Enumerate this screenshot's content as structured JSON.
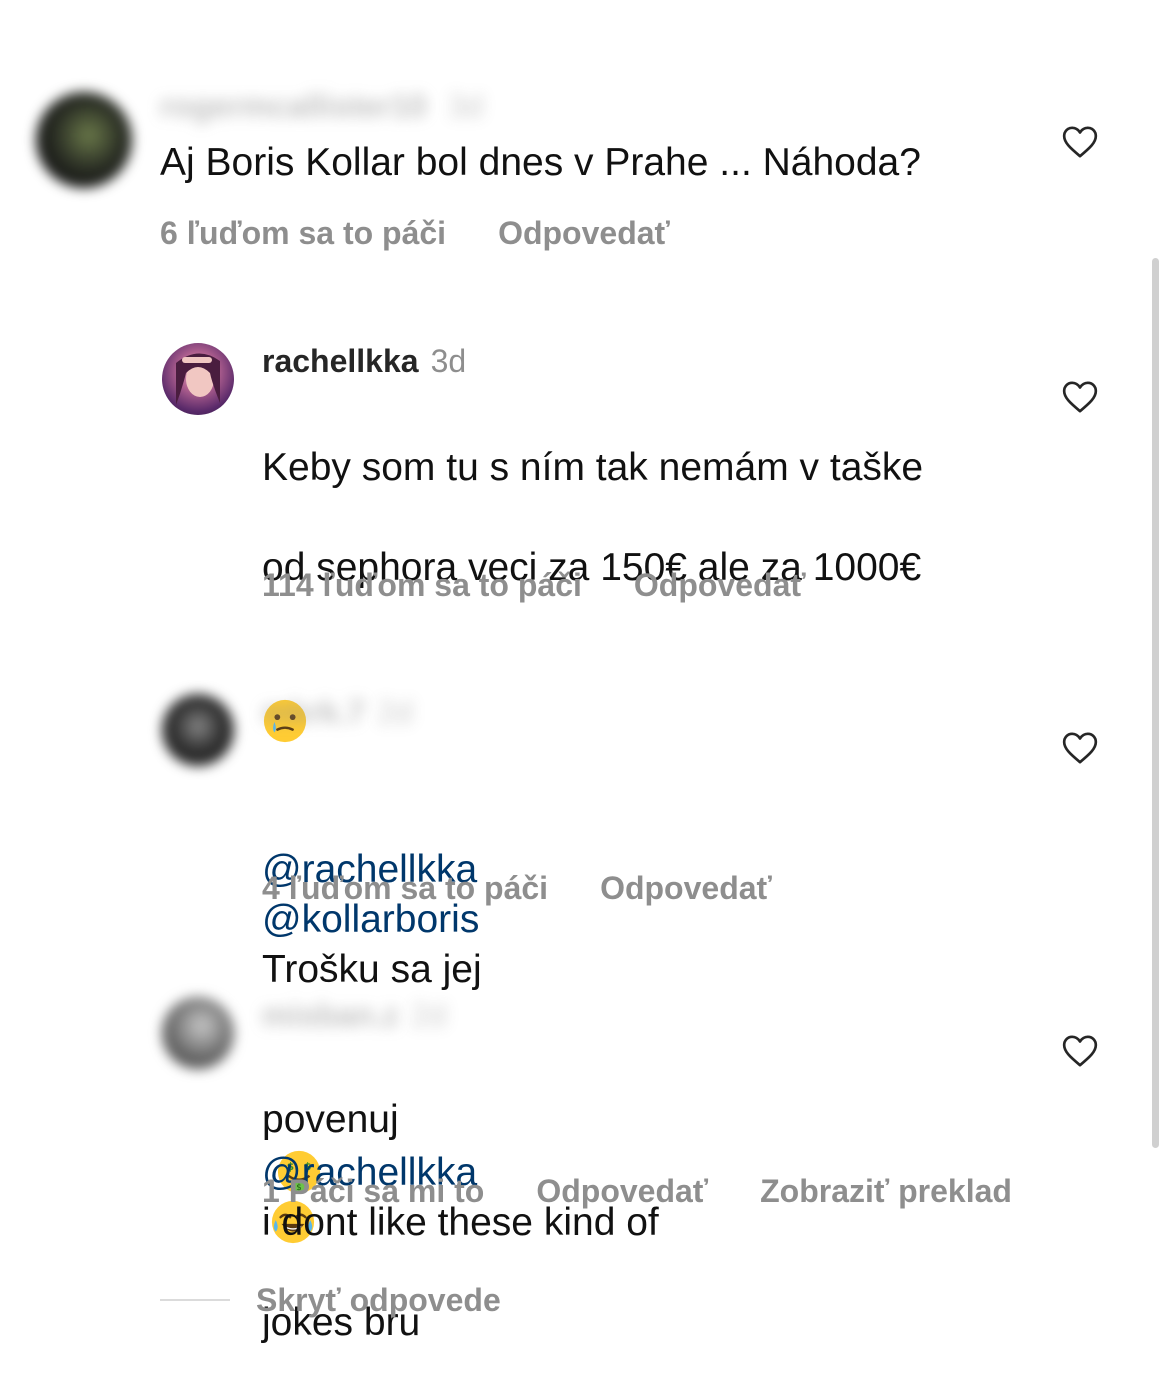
{
  "colors": {
    "text": "#111111",
    "muted": "#8e8e8e",
    "mention": "#00376b",
    "background": "#ffffff"
  },
  "comments": [
    {
      "username": "rogermcallister10",
      "time": "3d",
      "text": "Aj Boris Kollar bol dnes v Prahe ... Náhoda?",
      "likes_label": "6 ľuďom sa to páči",
      "reply_label": "Odpovedať",
      "icon": "heart-outline-icon"
    },
    {
      "username": "rachellkka",
      "time": "3d",
      "text_line1": "Keby som tu s ním tak nemám v taške",
      "text_line2": "od sephora veci za 150€ ale za 1000€",
      "emoji": "crying-face-emoji",
      "likes_label": "114 ľuďom sa to páči",
      "reply_label": "Odpovedať",
      "icon": "heart-outline-icon"
    },
    {
      "username": "mkrk.7",
      "time": "2d",
      "mention1": "@rachellkka",
      "mention2": "@kollarboris",
      "text_after": "Trošku sa jej",
      "text_line2": "povenuj",
      "emojis": [
        "money-mouth-face-emoji",
        "tears-of-joy-emoji"
      ],
      "likes_label": "4 ľuďom sa to páči",
      "reply_label": "Odpovedať",
      "icon": "heart-outline-icon"
    },
    {
      "username": "misban.z",
      "time": "2d",
      "mention": "@rachellkka",
      "text_after": "i dont like these kind of",
      "text_line2": "jokes bru",
      "likes_label": "1 Páči sa mi to",
      "reply_label": "Odpovedať",
      "translate_label": "Zobraziť preklad",
      "icon": "heart-outline-icon"
    }
  ],
  "hide_replies_label": "Skryť odpovede"
}
